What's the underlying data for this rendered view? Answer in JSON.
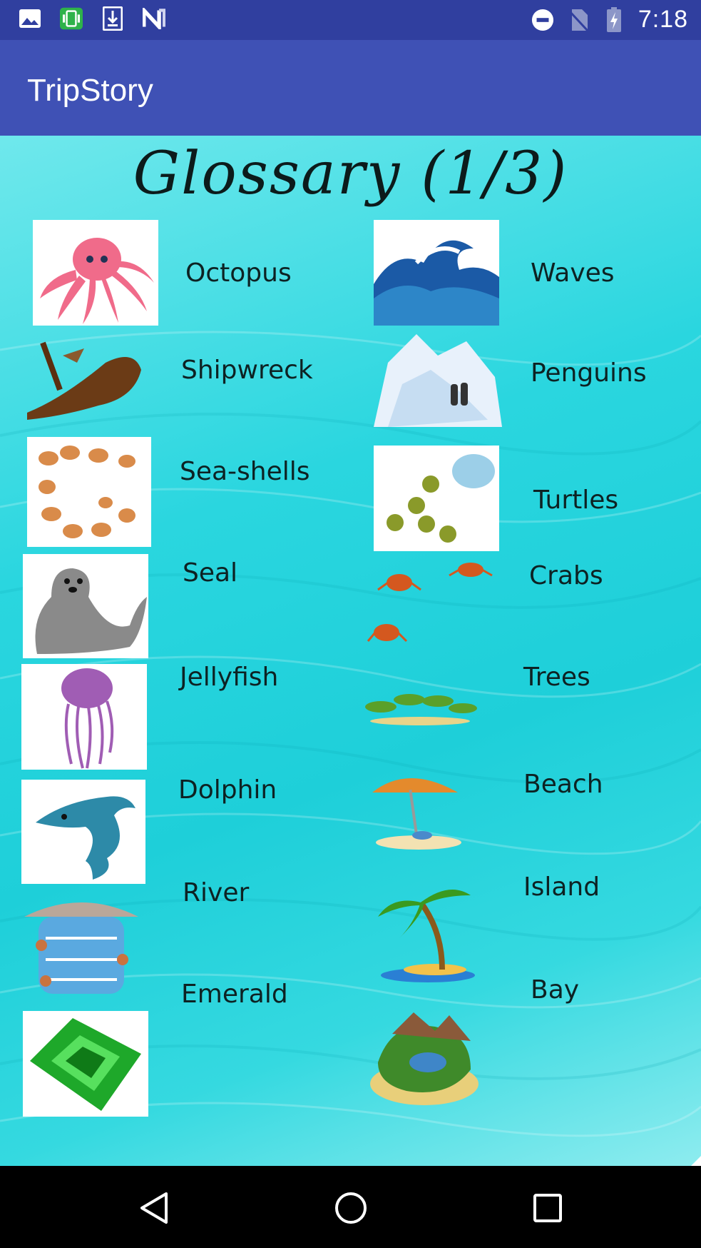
{
  "status_bar": {
    "time": "7:18",
    "left_icons": [
      "image-icon",
      "screenshot-icon",
      "download-icon",
      "n-logo-icon"
    ],
    "right_icons": [
      "do-not-disturb-icon",
      "no-sim-icon",
      "battery-charging-icon"
    ]
  },
  "app_bar": {
    "title": "TripStory"
  },
  "content": {
    "title": "Glossary (1/3)",
    "items": [
      {
        "label": "Octopus",
        "icon": "octopus-icon"
      },
      {
        "label": "Waves",
        "icon": "waves-icon"
      },
      {
        "label": "Shipwreck",
        "icon": "shipwreck-icon"
      },
      {
        "label": "Penguins",
        "icon": "penguins-icon"
      },
      {
        "label": "Sea-shells",
        "icon": "sea-shells-icon"
      },
      {
        "label": "Turtles",
        "icon": "turtles-icon"
      },
      {
        "label": "Seal",
        "icon": "seal-icon"
      },
      {
        "label": "Crabs",
        "icon": "crabs-icon"
      },
      {
        "label": "Jellyfish",
        "icon": "jellyfish-icon"
      },
      {
        "label": "Trees",
        "icon": "trees-icon"
      },
      {
        "label": "Dolphin",
        "icon": "dolphin-icon"
      },
      {
        "label": "Beach",
        "icon": "beach-icon"
      },
      {
        "label": "River",
        "icon": "river-icon"
      },
      {
        "label": "Island",
        "icon": "island-icon"
      },
      {
        "label": "Emerald",
        "icon": "emerald-icon"
      },
      {
        "label": "Bay",
        "icon": "bay-icon"
      }
    ]
  },
  "nav_bar": {
    "buttons": [
      "back-icon",
      "home-icon",
      "recents-icon"
    ]
  },
  "colors": {
    "status_bar": "#303f9f",
    "app_bar": "#3f51b5",
    "water": "#1ecfd9",
    "nav_bar": "#000000"
  }
}
